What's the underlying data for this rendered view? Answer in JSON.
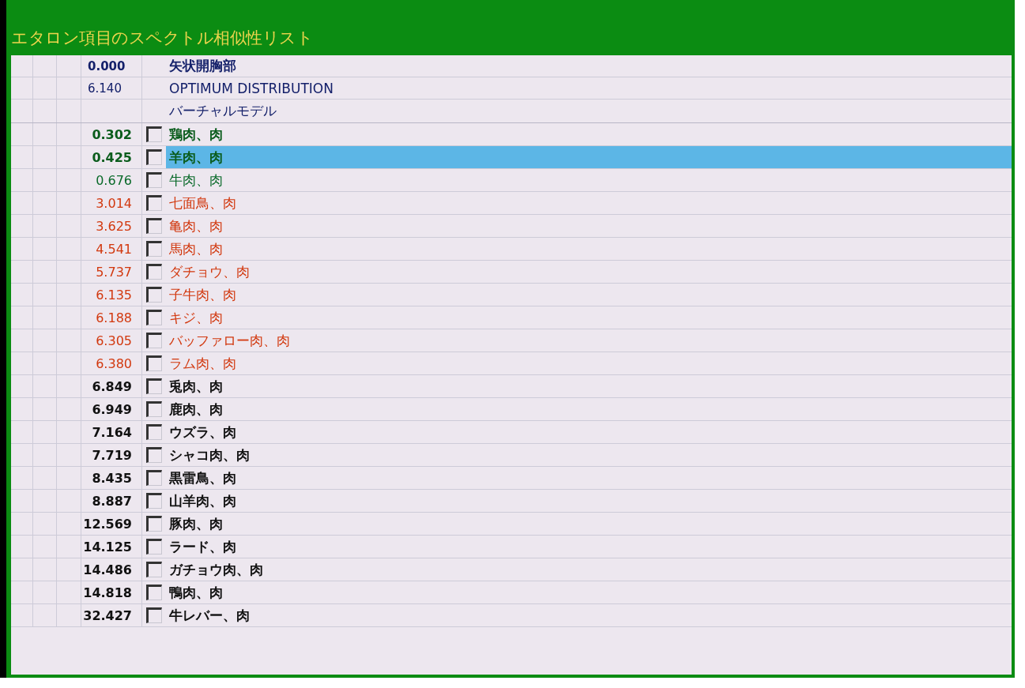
{
  "window": {
    "title": "エタロン項目のスペクトル相似性リスト"
  },
  "rows": [
    {
      "kind": "reference",
      "value": "0.000",
      "name": "矢状開胸部",
      "color": "#14206a",
      "emphasis": true,
      "selected": false
    },
    {
      "kind": "reference",
      "value": "6.140",
      "name": "OPTIMUM DISTRIBUTION",
      "color": "#14206a",
      "emphasis": false,
      "selected": false
    },
    {
      "kind": "reference",
      "name": "バーチャルモデル",
      "color": "#14206a",
      "emphasis": false,
      "selected": false
    },
    {
      "kind": "candidate",
      "value": "0.302",
      "name": "鶏肉、肉",
      "color": "#0a5c1c",
      "emphasis": true,
      "checked": false,
      "selected": false
    },
    {
      "kind": "candidate",
      "value": "0.425",
      "name": "羊肉、肉",
      "color": "#0a5c1c",
      "emphasis": true,
      "checked": false,
      "selected": true
    },
    {
      "kind": "candidate",
      "value": "0.676",
      "name": "牛肉、肉",
      "color": "#0a6a2a",
      "emphasis": false,
      "checked": false,
      "selected": false
    },
    {
      "kind": "candidate",
      "value": "3.014",
      "name": "七面鳥、肉",
      "color": "#d2380e",
      "emphasis": false,
      "checked": false,
      "selected": false
    },
    {
      "kind": "candidate",
      "value": "3.625",
      "name": "亀肉、肉",
      "color": "#d2380e",
      "emphasis": false,
      "checked": false,
      "selected": false
    },
    {
      "kind": "candidate",
      "value": "4.541",
      "name": "馬肉、肉",
      "color": "#d2380e",
      "emphasis": false,
      "checked": false,
      "selected": false
    },
    {
      "kind": "candidate",
      "value": "5.737",
      "name": "ダチョウ、肉",
      "color": "#d2380e",
      "emphasis": false,
      "checked": false,
      "selected": false
    },
    {
      "kind": "candidate",
      "value": "6.135",
      "name": "子牛肉、肉",
      "color": "#d2380e",
      "emphasis": false,
      "checked": false,
      "selected": false
    },
    {
      "kind": "candidate",
      "value": "6.188",
      "name": "キジ、肉",
      "color": "#d2380e",
      "emphasis": false,
      "checked": false,
      "selected": false
    },
    {
      "kind": "candidate",
      "value": "6.305",
      "name": "バッファロー肉、肉",
      "color": "#d2380e",
      "emphasis": false,
      "checked": false,
      "selected": false
    },
    {
      "kind": "candidate",
      "value": "6.380",
      "name": "ラム肉、肉",
      "color": "#d2380e",
      "emphasis": false,
      "checked": false,
      "selected": false
    },
    {
      "kind": "candidate",
      "value": "6.849",
      "name": "兎肉、肉",
      "color": "#111111",
      "emphasis": true,
      "checked": false,
      "selected": false
    },
    {
      "kind": "candidate",
      "value": "6.949",
      "name": "鹿肉、肉",
      "color": "#111111",
      "emphasis": true,
      "checked": false,
      "selected": false
    },
    {
      "kind": "candidate",
      "value": "7.164",
      "name": "ウズラ、肉",
      "color": "#111111",
      "emphasis": true,
      "checked": false,
      "selected": false
    },
    {
      "kind": "candidate",
      "value": "7.719",
      "name": "シャコ肉、肉",
      "color": "#111111",
      "emphasis": true,
      "checked": false,
      "selected": false
    },
    {
      "kind": "candidate",
      "value": "8.435",
      "name": "黒雷鳥、肉",
      "color": "#111111",
      "emphasis": true,
      "checked": false,
      "selected": false
    },
    {
      "kind": "candidate",
      "value": "8.887",
      "name": "山羊肉、肉",
      "color": "#111111",
      "emphasis": true,
      "checked": false,
      "selected": false
    },
    {
      "kind": "candidate",
      "value": "12.569",
      "name": "豚肉、肉",
      "color": "#111111",
      "emphasis": true,
      "checked": false,
      "selected": false
    },
    {
      "kind": "candidate",
      "value": "14.125",
      "name": "ラード、肉",
      "color": "#111111",
      "emphasis": true,
      "checked": false,
      "selected": false
    },
    {
      "kind": "candidate",
      "value": "14.486",
      "name": "ガチョウ肉、肉",
      "color": "#111111",
      "emphasis": true,
      "checked": false,
      "selected": false
    },
    {
      "kind": "candidate",
      "value": "14.818",
      "name": "鴨肉、肉",
      "color": "#111111",
      "emphasis": true,
      "checked": false,
      "selected": false
    },
    {
      "kind": "candidate",
      "value": "32.427",
      "name": "牛レバー、肉",
      "color": "#111111",
      "emphasis": true,
      "checked": false,
      "selected": false
    }
  ]
}
